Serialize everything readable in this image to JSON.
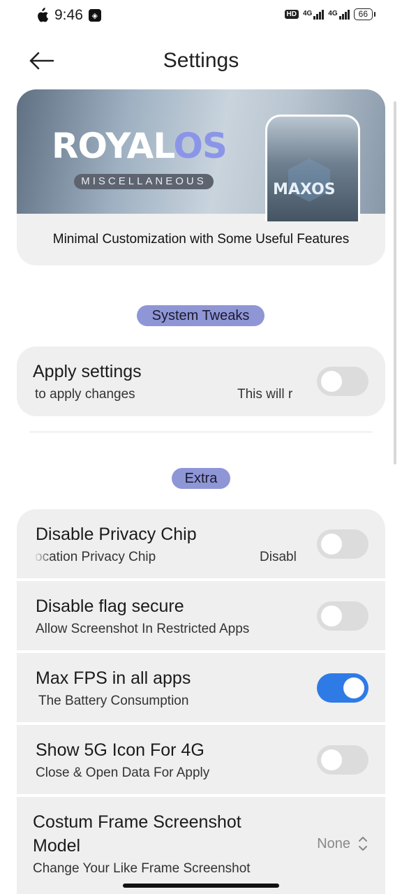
{
  "status_bar": {
    "time": "9:46",
    "hd_label": "HD",
    "net1": "4G",
    "net2": "4G",
    "battery": "66"
  },
  "header": {
    "title": "Settings"
  },
  "banner": {
    "brand_white": "ROYAL",
    "brand_blue": "OS",
    "subtitle": "MISCELLANEOUS",
    "phone_logo": "MAXOS",
    "tagline": "Minimal Customization with Some Useful Features"
  },
  "sections": {
    "system_tweaks": "System Tweaks",
    "extra": "Extra"
  },
  "apply": {
    "title": "Apply settings",
    "sub_left": "to apply changes",
    "sub_right": "This will r",
    "enabled": false
  },
  "items": [
    {
      "title": "Disable Privacy Chip",
      "sub_left": "ocation Privacy Chip",
      "sub_right": "Disabl",
      "enabled": false
    },
    {
      "title": "Disable flag secure",
      "sub": "Allow Screenshot In Restricted Apps",
      "enabled": false
    },
    {
      "title": "Max FPS in all apps",
      "sub": "The Battery Consumption",
      "enabled": true
    },
    {
      "title": "Show 5G Icon For 4G",
      "sub": "Close & Open Data For Apply",
      "enabled": false
    },
    {
      "title_line1": "Costum Frame Screenshot",
      "title_line2": "Model",
      "sub": "Change Your Like Frame Screenshot",
      "value": "None"
    }
  ],
  "colors": {
    "accent": "#2e7be6",
    "chip": "#8f96d6",
    "card": "#efefef"
  }
}
